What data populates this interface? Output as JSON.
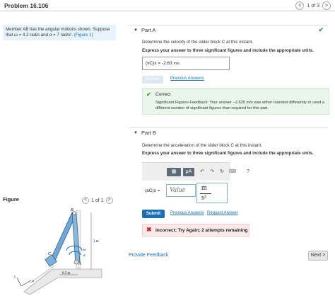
{
  "header": {
    "title": "Problem 16.106",
    "page": "1 of 3",
    "prev": "<",
    "next": ">"
  },
  "statement": {
    "line1": "Member AB has the angular motions shown. Suppose",
    "line2_prefix": "that ω = 4.2 rad/s and α = 7 rad/s². ",
    "figure_link": "(Figure 1)"
  },
  "figure": {
    "label": "Figure",
    "page": "1 of 1",
    "labels": {
      "B": "B",
      "C": "C",
      "A": "A",
      "x": "x",
      "y": "y",
      "omega": "ω",
      "alpha": "α",
      "dim_2m": "2 m",
      "dim_05m": "0.5 m"
    }
  },
  "partA": {
    "label": "Part A",
    "question": "Determine the velocity of the slider block C at this instant.",
    "instruction": "Express your answer to three significant figures and include the appropriate units.",
    "answer_label": "(vC)x =",
    "answer_value": "-2.63",
    "answer_unit_num": "m",
    "answer_unit_den": "s",
    "submit": "Submit",
    "previous_answers": "Previous Answers",
    "correct_title": "Correct",
    "feedback": "Significant Figures Feedback: Your answer −2.625 m/s was either rounded differently or used a different number of significant figures than required for this part."
  },
  "partB": {
    "label": "Part B",
    "question": "Determine the acceleration of the slider block C at this instant.",
    "instruction": "Express your answer to three significant figures and include the appropriate units.",
    "toolbar": {
      "templates": "▦",
      "mu_a": "μA",
      "undo": "↶",
      "redo": "↷",
      "reset": "↻",
      "keyboard": "⌨",
      "help": "?"
    },
    "answer_label": "(aC)x =",
    "value_placeholder": "Value",
    "unit_num": "m",
    "unit_den": "s²",
    "submit": "Submit",
    "previous_answers": "Previous Answers",
    "request_answer": "Request Answer",
    "incorrect": "Incorrect; Try Again; 2 attempts remaining"
  },
  "footer": {
    "provide_feedback": "Provide Feedback",
    "next": "Next"
  },
  "colors": {
    "accent": "#1a6fb3",
    "correct": "#3c9a3c",
    "incorrect": "#c62828"
  }
}
